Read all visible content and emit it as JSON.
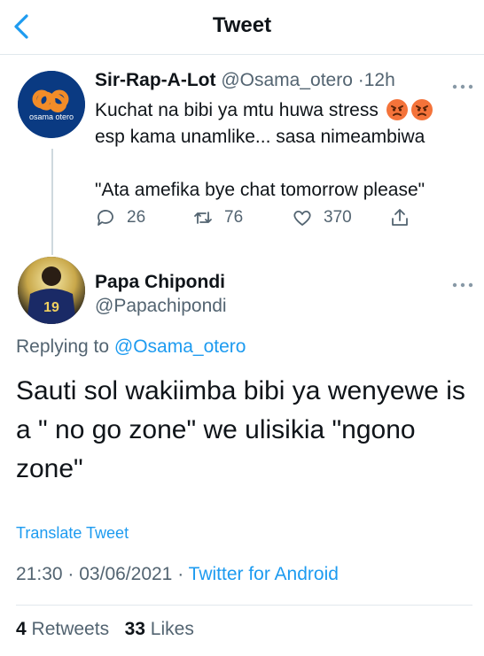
{
  "header": {
    "title": "Tweet"
  },
  "parent_tweet": {
    "avatar_text": "osama otero",
    "name": "Sir-Rap-A-Lot",
    "handle": "@Osama_otero",
    "separator": "·",
    "time": "12h",
    "text_line1": "Kuchat na bibi ya mtu huwa stress",
    "text_line2": "esp kama unamlike... sasa nimeambiwa",
    "text_line3": "\"Ata amefika bye chat tomorrow please\"",
    "emoji": "angry-face-icon",
    "reply_count": "26",
    "retweet_count": "76",
    "like_count": "370"
  },
  "reply_tweet": {
    "avatar_jersey": "19",
    "name": "Papa Chipondi",
    "handle": "@Papachipondi",
    "replying_prefix": "Replying to",
    "replying_to": "@Osama_otero",
    "text": "Sauti sol wakiimba bibi ya wenyewe is a \" no go zone\" we ulisikia \"ngono zone\"",
    "translate": "Translate Tweet",
    "time": "21:30",
    "date": "03/06/2021",
    "separator": "·",
    "source": "Twitter for Android",
    "retweets_count": "4",
    "retweets_label": "Retweets",
    "likes_count": "33",
    "likes_label": "Likes"
  },
  "colors": {
    "accent": "#1d9bf0",
    "secondary_text": "#536471",
    "divider": "#e1e8ed"
  }
}
